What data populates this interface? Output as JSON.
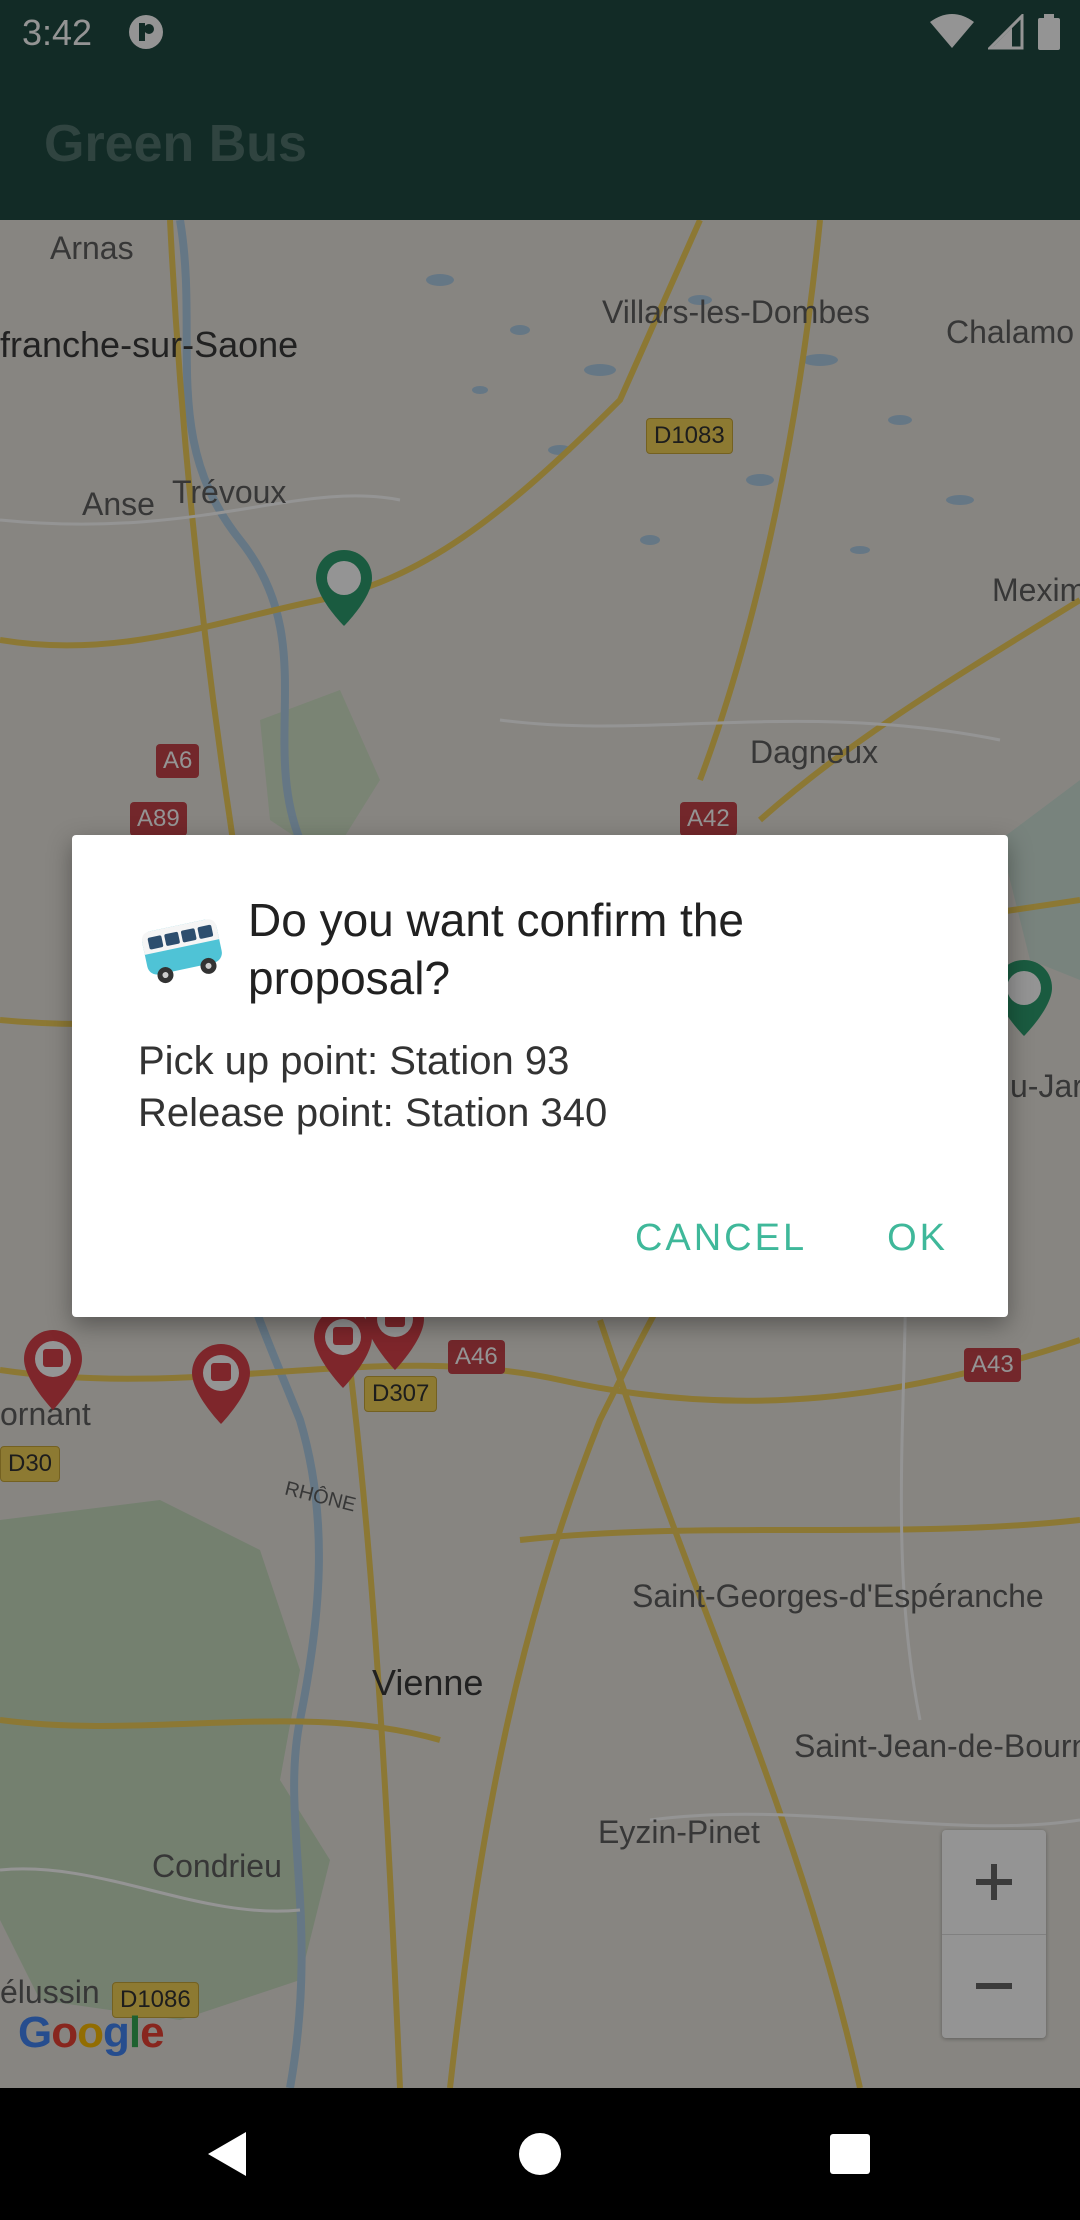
{
  "status_bar": {
    "time": "3:42",
    "icons": [
      "app-notification-icon",
      "wifi-icon",
      "cell-signal-icon",
      "battery-icon"
    ]
  },
  "app_bar": {
    "title": "Green Bus"
  },
  "map": {
    "labels": [
      {
        "id": "arnas",
        "text": "Arnas"
      },
      {
        "id": "villefranche",
        "text": "franche-sur-Saone"
      },
      {
        "id": "villars",
        "text": "Villars-les-Dombes"
      },
      {
        "id": "chalamont",
        "text": "Chalamo"
      },
      {
        "id": "anse",
        "text": "Anse"
      },
      {
        "id": "trevoux",
        "text": "Trévoux"
      },
      {
        "id": "meximieux",
        "text": "Mexim"
      },
      {
        "id": "dagneux",
        "text": "Dagneux"
      },
      {
        "id": "ornant",
        "text": "ornant"
      },
      {
        "id": "saint-georges",
        "text": "Saint-Georges-d'Espéranche"
      },
      {
        "id": "vienne",
        "text": "Vienne"
      },
      {
        "id": "saint-jean",
        "text": "Saint-Jean-de-Bourn"
      },
      {
        "id": "eyzin",
        "text": "Eyzin-Pinet"
      },
      {
        "id": "condrieu",
        "text": "Condrieu"
      },
      {
        "id": "pelussin",
        "text": "élussin"
      },
      {
        "id": "ujan",
        "text": "u-Jar"
      },
      {
        "id": "rhone",
        "text": "RHÔNE"
      }
    ],
    "road_badges": [
      {
        "id": "d1083",
        "text": "D1083"
      },
      {
        "id": "a6",
        "text": "A6"
      },
      {
        "id": "a89",
        "text": "A89"
      },
      {
        "id": "a42",
        "text": "A42"
      },
      {
        "id": "a46",
        "text": "A46"
      },
      {
        "id": "d307",
        "text": "D307"
      },
      {
        "id": "a43",
        "text": "A43"
      },
      {
        "id": "d30",
        "text": "D30"
      },
      {
        "id": "d1086",
        "text": "D1086"
      }
    ],
    "zoom_in": "+",
    "zoom_out": "−",
    "attribution": "Google"
  },
  "dialog": {
    "icon": "bus-icon",
    "title": "Do you want confirm the proposal?",
    "pickup": "Pick up point: Station 93",
    "release": "Release point: Station 340",
    "cancel_label": "CANCEL",
    "ok_label": "OK",
    "accent_color": "#3fb89a"
  },
  "colors": {
    "app_bar": "#1f4a42",
    "accent": "#3fb89a",
    "pin_red": "#d9434b",
    "pin_green": "#2e9e6e"
  }
}
